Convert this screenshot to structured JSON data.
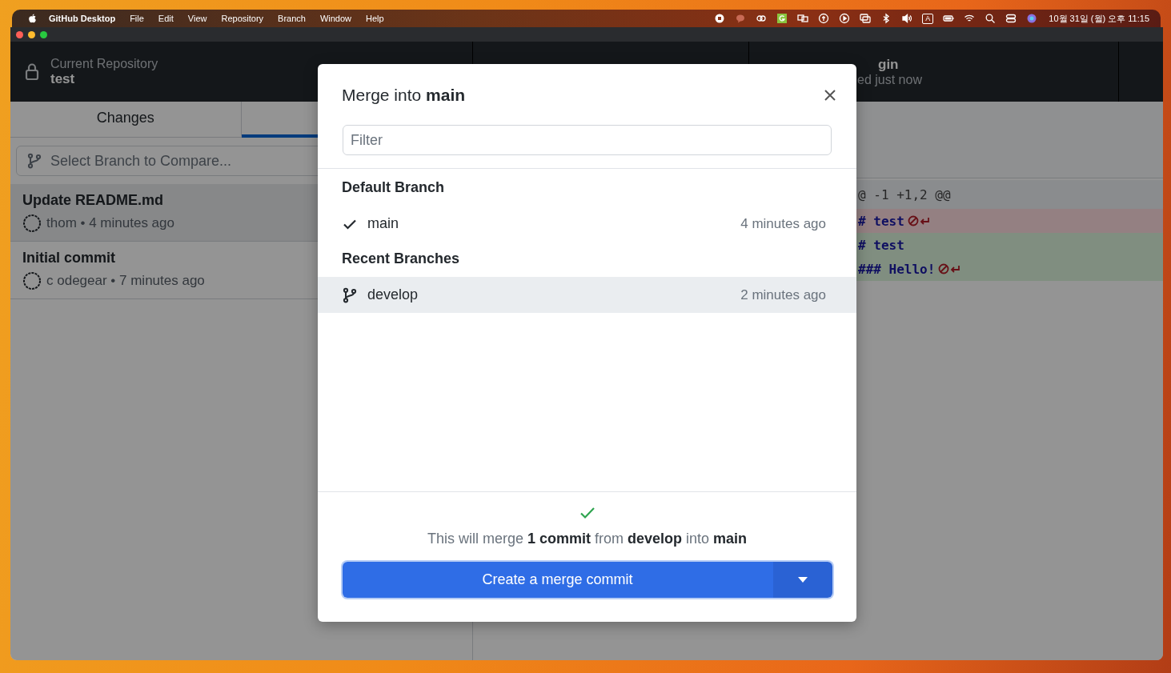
{
  "menu_bar": {
    "app": "GitHub Desktop",
    "menus": [
      "File",
      "Edit",
      "View",
      "Repository",
      "Branch",
      "Window",
      "Help"
    ],
    "input_indicator": "A",
    "clock": "10월 31일 (월) 오후 11:15"
  },
  "toolbar": {
    "repository": {
      "label": "Current Repository",
      "value": "test"
    },
    "fetch": {
      "label": "gin",
      "detail": "ed just now"
    }
  },
  "tabs": [
    {
      "label": "Changes",
      "selected": false
    },
    {
      "selected": true
    }
  ],
  "compare": {
    "placeholder": "Select Branch to Compare..."
  },
  "commits": [
    {
      "title": "Update README.md",
      "meta": "thom • 4 minutes ago",
      "selected": true
    },
    {
      "title": "Initial commit",
      "meta": "c odegear • 7 minutes ago",
      "selected": false
    }
  ],
  "diff": [
    {
      "kind": "hunk",
      "text": "@ -1 +1,2 @@",
      "no_newline": false
    },
    {
      "kind": "deleted",
      "text": "# test",
      "no_newline": true
    },
    {
      "kind": "added",
      "text": "# test",
      "no_newline": false
    },
    {
      "kind": "added",
      "text": "### Hello!",
      "no_newline": true
    }
  ],
  "dialog": {
    "title": "Merge into **main**",
    "filter": {
      "placeholder": "Filter"
    },
    "sections": [
      {
        "heading": "Default Branch",
        "branches": [
          {
            "name": "main",
            "time": "4 minutes ago",
            "current": true,
            "selected": false
          }
        ]
      },
      {
        "heading": "Recent Branches",
        "branches": [
          {
            "name": "develop",
            "time": "2 minutes ago",
            "current": false,
            "selected": true
          }
        ]
      }
    ],
    "summary": "This will merge **1 commit** from **develop** into **main**",
    "button": "Create a merge commit"
  }
}
